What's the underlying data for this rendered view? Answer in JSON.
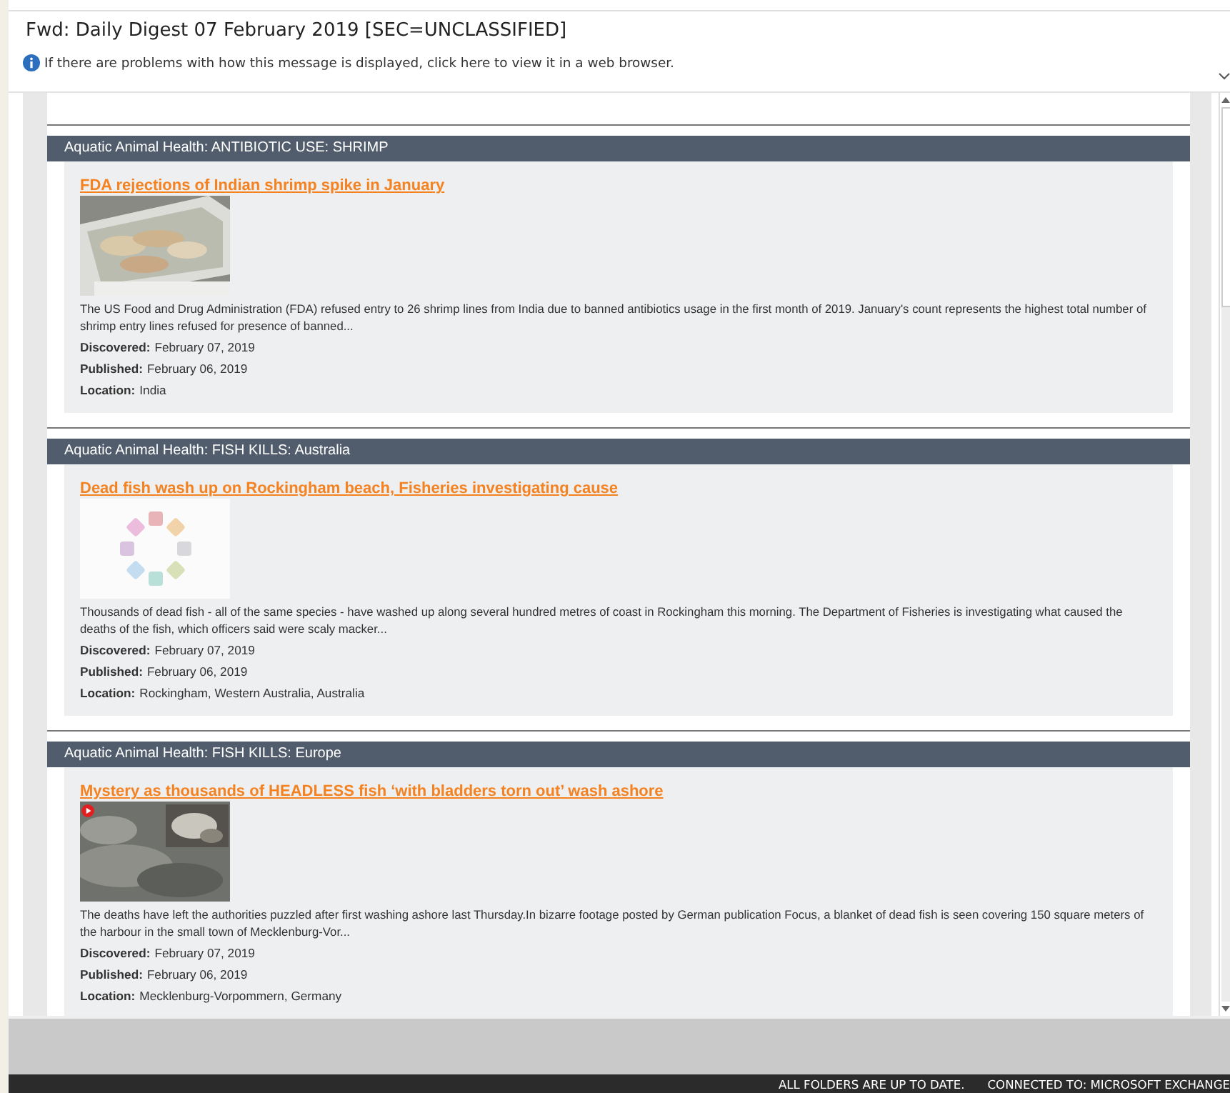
{
  "message": {
    "title": "Fwd: Daily Digest 07 February 2019 [SEC=UNCLASSIFIED]",
    "info": "If there are problems with how this message is displayed, click here to view it in a web browser."
  },
  "sections": [
    {
      "header": "Aquatic Animal Health: ANTIBIOTIC USE: SHRIMP",
      "headline": "FDA rejections of Indian shrimp spike in January",
      "summary": "The US Food and Drug Administration (FDA) refused entry to 26 shrimp lines from India due to banned antibiotics usage in the first month of 2019. January's count represents the highest total number of shrimp entry lines refused for presence of banned...",
      "fields": [
        {
          "label": "Discovered:",
          "value": "February 07, 2019"
        },
        {
          "label": "Published:",
          "value": "February 06, 2019"
        },
        {
          "label": "Location:",
          "value": "India"
        }
      ]
    },
    {
      "header": "Aquatic Animal Health: FISH KILLS: Australia",
      "headline": "Dead fish wash up on Rockingham beach, Fisheries investigating cause",
      "image": {
        "kind": "loading"
      },
      "summary": "Thousands of dead fish - all of the same species - have washed up along several hundred metres of coast in Rockingham this morning. The Department of Fisheries is investigating what caused the deaths of the fish, which officers said were scaly macker...",
      "fields": [
        {
          "label": "Discovered:",
          "value": "February 07, 2019"
        },
        {
          "label": "Published:",
          "value": "February 06, 2019"
        },
        {
          "label": "Location:",
          "value": "Rockingham, Western Australia, Australia"
        }
      ]
    },
    {
      "header": "Aquatic Animal Health: FISH KILLS: Europe",
      "headline": "Mystery as thousands of HEADLESS fish ‘with bladders torn out’ wash ashore",
      "image": {
        "kind": "video"
      },
      "summary": "The deaths have left the authorities puzzled after first washing ashore last Thursday.In bizarre footage posted by German publication Focus, a blanket of dead fish is seen covering 150 square meters of the harbour in the small town of Mecklenburg-Vor...",
      "fields": [
        {
          "label": "Discovered:",
          "value": "February 07, 2019"
        },
        {
          "label": "Published:",
          "value": "February 06, 2019"
        },
        {
          "label": "Location:",
          "value": "Mecklenburg-Vorpommern, Germany"
        }
      ]
    }
  ],
  "status_bar": [
    "ALL FOLDERS ARE UP TO DATE.",
    "CONNECTED TO: MICROSOFT EXCHANGE"
  ]
}
